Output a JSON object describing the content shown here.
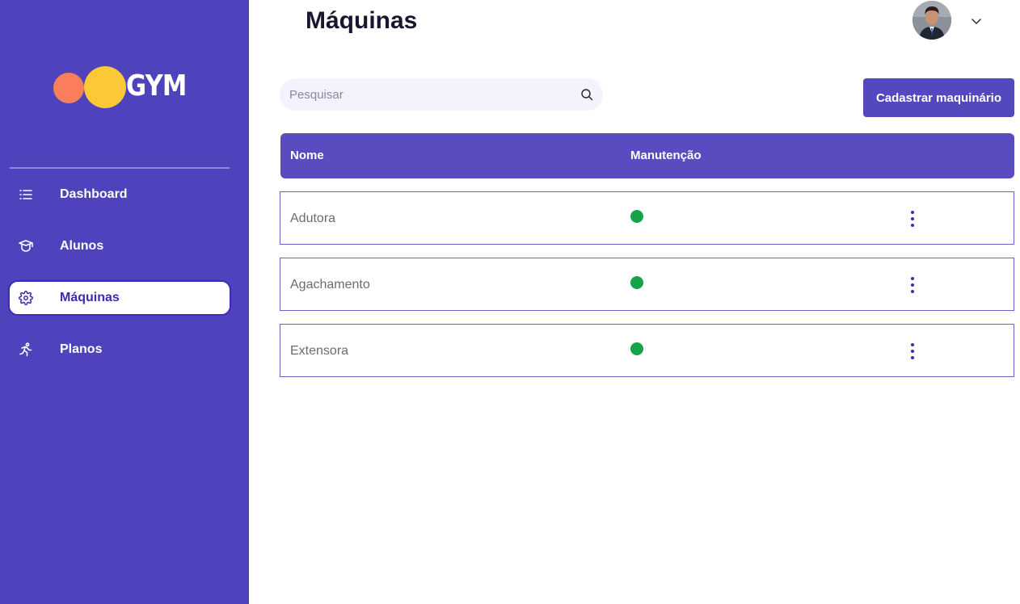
{
  "brand": {
    "logo_text": "GYM",
    "circle_left_color": "#fb7e5c",
    "circle_right_color": "#fdc838"
  },
  "sidebar": {
    "background": "#4f42bd",
    "items": [
      {
        "label": "Dashboard",
        "icon": "list-icon",
        "active": false
      },
      {
        "label": "Alunos",
        "icon": "graduation-cap-icon",
        "active": false
      },
      {
        "label": "Máquinas",
        "icon": "gear-icon",
        "active": true
      },
      {
        "label": "Planos",
        "icon": "running-person-icon",
        "active": false
      }
    ]
  },
  "header": {
    "title": "Máquinas",
    "avatar_icon": "user-avatar",
    "menu_icon": "chevron-down-icon"
  },
  "toolbar": {
    "search_placeholder": "Pesquisar",
    "search_value": "",
    "search_icon": "search-icon",
    "add_button_label": "Cadastrar maquinário"
  },
  "table": {
    "columns": [
      "Nome",
      "Manutenção"
    ],
    "rows": [
      {
        "name": "Adutora",
        "maintenance_status": "ok",
        "status_color": "#16a34a",
        "actions_icon": "more-vertical-icon"
      },
      {
        "name": "Agachamento",
        "maintenance_status": "ok",
        "status_color": "#16a34a",
        "actions_icon": "more-vertical-icon"
      },
      {
        "name": "Extensora",
        "maintenance_status": "ok",
        "status_color": "#16a34a",
        "actions_icon": "more-vertical-icon"
      }
    ]
  },
  "colors": {
    "accent": "#5448bf",
    "header_row": "#594cc0",
    "active_text": "#3b2db0"
  }
}
